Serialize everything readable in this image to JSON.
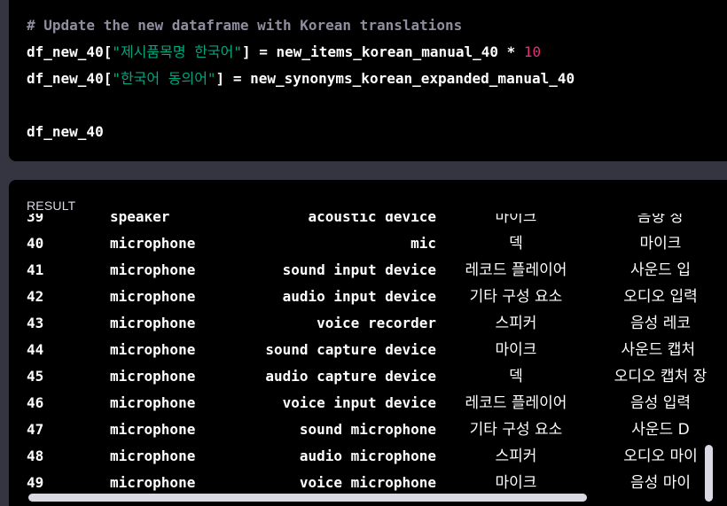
{
  "code": {
    "comment": "# Update the new dataframe with Korean translations",
    "line2": {
      "var": "df_new_40[",
      "key": "\"제시품목명 한국어\"",
      "rest": "] = new_items_korean_manual_40 * ",
      "num": "10"
    },
    "line3": {
      "var": "df_new_40[",
      "key": "\"한국어 동의어\"",
      "rest": "] = new_synonyms_korean_expanded_manual_40"
    },
    "line5": "df_new_40"
  },
  "result": {
    "label": "RESULT",
    "partial_row": {
      "index": "39",
      "category": "speaker",
      "item": "acoustic device",
      "korean": "마이크",
      "synonym": "음향 장"
    },
    "rows": [
      {
        "index": "40",
        "category": "microphone",
        "item": "mic",
        "korean": "덱",
        "synonym": "마이크"
      },
      {
        "index": "41",
        "category": "microphone",
        "item": "sound input device",
        "korean": "레코드 플레이어",
        "synonym": "사운드 입"
      },
      {
        "index": "42",
        "category": "microphone",
        "item": "audio input device",
        "korean": "기타 구성 요소",
        "synonym": "오디오 입력"
      },
      {
        "index": "43",
        "category": "microphone",
        "item": "voice recorder",
        "korean": "스피커",
        "synonym": "음성 레코"
      },
      {
        "index": "44",
        "category": "microphone",
        "item": "sound capture device",
        "korean": "마이크",
        "synonym": "사운드 캡처 "
      },
      {
        "index": "45",
        "category": "microphone",
        "item": "audio capture device",
        "korean": "덱",
        "synonym": "오디오 캡처 장"
      },
      {
        "index": "46",
        "category": "microphone",
        "item": "voice input device",
        "korean": "레코드 플레이어",
        "synonym": "음성 입력"
      },
      {
        "index": "47",
        "category": "microphone",
        "item": "sound microphone",
        "korean": "기타 구성 요소",
        "synonym": "사운드 D"
      },
      {
        "index": "48",
        "category": "microphone",
        "item": "audio microphone",
        "korean": "스피커",
        "synonym": "오디오 마이"
      },
      {
        "index": "49",
        "category": "microphone",
        "item": "voice microphone",
        "korean": "마이크",
        "synonym": "음성 마이"
      }
    ]
  },
  "colors": {
    "background": "#343541",
    "panel": "#000000",
    "comment": "#8e8ea0",
    "string": "#00a67d",
    "number": "#df3079",
    "scrollbar": "#d9d9e3"
  }
}
